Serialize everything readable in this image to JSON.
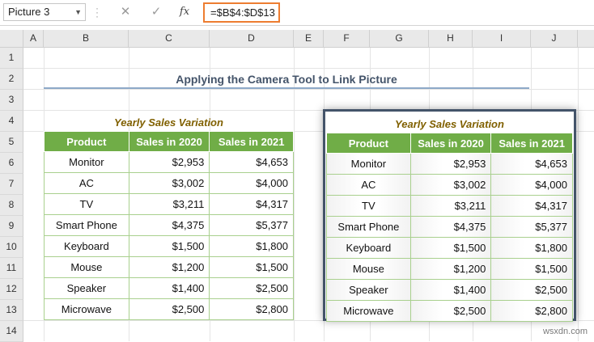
{
  "formula_bar": {
    "name_box": "Picture 3",
    "cancel_icon": "✕",
    "enter_icon": "✓",
    "fx_label": "fx",
    "formula": "=$B$4:$D$13"
  },
  "columns": [
    "A",
    "B",
    "C",
    "D",
    "E",
    "F",
    "G",
    "H",
    "I",
    "J"
  ],
  "rows": [
    "1",
    "2",
    "3",
    "4",
    "5",
    "6",
    "7",
    "8",
    "9",
    "10",
    "11",
    "12",
    "13",
    "14"
  ],
  "sheet_title": "Applying the Camera Tool to Link Picture",
  "table": {
    "caption": "Yearly Sales Variation",
    "headers": [
      "Product",
      "Sales in 2020",
      "Sales in 2021"
    ],
    "rows": [
      [
        "Monitor",
        "$2,953",
        "$4,653"
      ],
      [
        "AC",
        "$3,002",
        "$4,000"
      ],
      [
        "TV",
        "$3,211",
        "$4,317"
      ],
      [
        "Smart Phone",
        "$4,375",
        "$5,377"
      ],
      [
        "Keyboard",
        "$1,500",
        "$1,800"
      ],
      [
        "Mouse",
        "$1,200",
        "$1,500"
      ],
      [
        "Speaker",
        "$1,400",
        "$2,500"
      ],
      [
        "Microwave",
        "$2,500",
        "$2,800"
      ]
    ]
  },
  "picture": {
    "caption": "Yearly Sales Variation",
    "headers": [
      "Product",
      "Sales in 2020",
      "Sales in 2021"
    ],
    "rows": [
      [
        "Monitor",
        "$2,953",
        "$4,653"
      ],
      [
        "AC",
        "$3,002",
        "$4,000"
      ],
      [
        "TV",
        "$3,211",
        "$4,317"
      ],
      [
        "Smart Phone",
        "$4,375",
        "$5,377"
      ],
      [
        "Keyboard",
        "$1,500",
        "$1,800"
      ],
      [
        "Mouse",
        "$1,200",
        "$1,500"
      ],
      [
        "Speaker",
        "$1,400",
        "$2,500"
      ],
      [
        "Microwave",
        "$2,500",
        "$2,800"
      ]
    ]
  },
  "watermark": "wsxdn.com",
  "colors": {
    "header_green": "#70ad47",
    "caption_gold": "#806000",
    "title_slate": "#44546a",
    "formula_highlight": "#ed7d31"
  }
}
